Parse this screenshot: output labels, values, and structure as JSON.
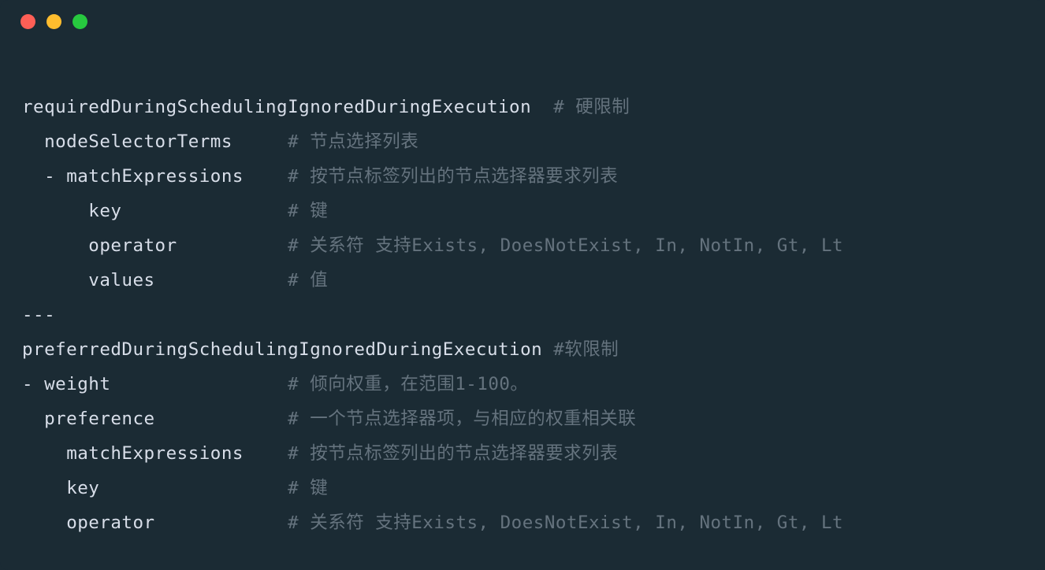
{
  "lines": [
    {
      "indent": "",
      "key": "requiredDuringSchedulingIgnoredDuringExecution  ",
      "comment": "# 硬限制"
    },
    {
      "indent": "  ",
      "key": "nodeSelectorTerms     ",
      "comment": "# 节点选择列表"
    },
    {
      "indent": "  - ",
      "key": "matchExpressions    ",
      "comment": "# 按节点标签列出的节点选择器要求列表"
    },
    {
      "indent": "      ",
      "key": "key               ",
      "comment": "# 键"
    },
    {
      "indent": "      ",
      "key": "operator          ",
      "comment": "# 关系符 支持Exists, DoesNotExist, In, NotIn, Gt, Lt"
    },
    {
      "indent": "      ",
      "key": "values            ",
      "comment": "# 值"
    },
    {
      "indent": "",
      "key": "---",
      "comment": ""
    },
    {
      "indent": "",
      "key": "preferredDuringSchedulingIgnoredDuringExecution ",
      "comment": "#软限制"
    },
    {
      "indent": "- ",
      "key": "weight                ",
      "comment": "# 倾向权重，在范围1-100。"
    },
    {
      "indent": "  ",
      "key": "preference            ",
      "comment": "# 一个节点选择器项，与相应的权重相关联"
    },
    {
      "indent": "    ",
      "key": "matchExpressions    ",
      "comment": "# 按节点标签列出的节点选择器要求列表"
    },
    {
      "indent": "    ",
      "key": "key                 ",
      "comment": "# 键"
    },
    {
      "indent": "    ",
      "key": "operator            ",
      "comment": "# 关系符 支持Exists, DoesNotExist, In, NotIn, Gt, Lt"
    }
  ]
}
